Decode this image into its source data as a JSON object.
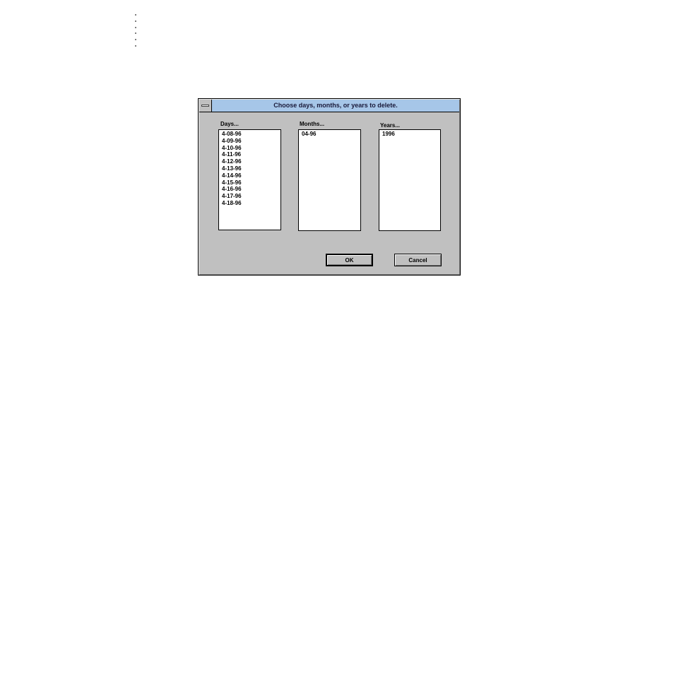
{
  "dialog": {
    "title": "Choose days, months, or years to delete.",
    "days": {
      "label": "Days...",
      "items": [
        "4-08-96",
        "4-09-96",
        "4-10-96",
        "4-11-96",
        "4-12-96",
        "4-13-96",
        "4-14-96",
        "4-15-96",
        "4-16-96",
        "4-17-96",
        "4-18-96"
      ]
    },
    "months": {
      "label": "Months...",
      "items": [
        "04-96"
      ]
    },
    "years": {
      "label": "Years...",
      "items": [
        "1996"
      ]
    },
    "buttons": {
      "ok": "OK",
      "cancel": "Cancel"
    }
  },
  "icons": {
    "system_menu": "system-menu-icon"
  },
  "colors": {
    "title_bar": "#a6c6e8",
    "dialog_face": "#c0c0c0"
  }
}
